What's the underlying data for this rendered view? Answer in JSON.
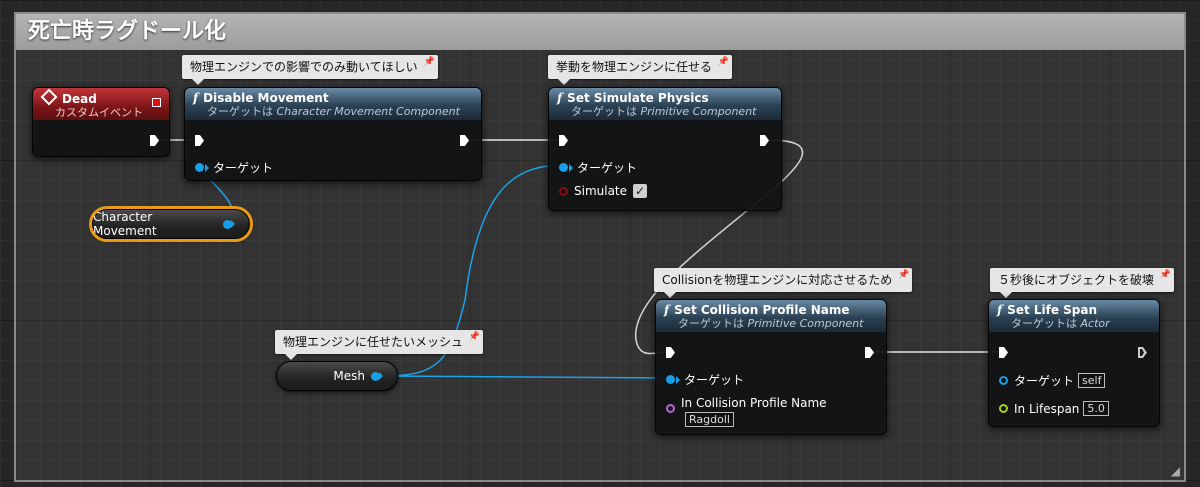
{
  "comment": {
    "title": "死亡時ラグドール化"
  },
  "bubbles": {
    "disable_movement": "物理エンジンでの影響でのみ動いてほしい",
    "simulate_physics": "挙動を物理エンジンに任せる",
    "mesh": "物理エンジンに任せたいメッシュ",
    "collision_profile": "Collisionを物理エンジンに対応させるため",
    "life_span": "５秒後にオブジェクトを破壊"
  },
  "dead_event": {
    "title": "Dead",
    "subtitle": "カスタムイベント"
  },
  "disable_movement": {
    "title": "Disable Movement",
    "target_prefix": "ターゲットは",
    "target_class": "Character Movement Component",
    "target_pin": "ターゲット"
  },
  "set_simulate_physics": {
    "title": "Set Simulate Physics",
    "target_prefix": "ターゲットは",
    "target_class": "Primitive Component",
    "target_pin": "ターゲット",
    "simulate_pin": "Simulate",
    "simulate_checked": "✓"
  },
  "set_collision_profile": {
    "title": "Set Collision Profile Name",
    "target_prefix": "ターゲットは",
    "target_class": "Primitive Component",
    "target_pin": "ターゲット",
    "profile_pin": "In Collision Profile Name",
    "profile_value": "Ragdoll"
  },
  "set_life_span": {
    "title": "Set Life Span",
    "target_prefix": "ターゲットは",
    "target_class": "Actor",
    "target_pin": "ターゲット",
    "target_value": "self",
    "lifespan_pin": "In Lifespan",
    "lifespan_value": "5.0"
  },
  "variables": {
    "character_movement": "Character Movement",
    "mesh": "Mesh"
  },
  "colors": {
    "exec_wire": "#e6e6e6",
    "object_wire": "#1aa3e8",
    "selection": "#e89a14",
    "event_header": "#b02a2f",
    "function_header": "#2f4a5e"
  },
  "icons": {
    "function": "f",
    "event": "diamond-icon",
    "comment_pin": "pin-icon"
  }
}
